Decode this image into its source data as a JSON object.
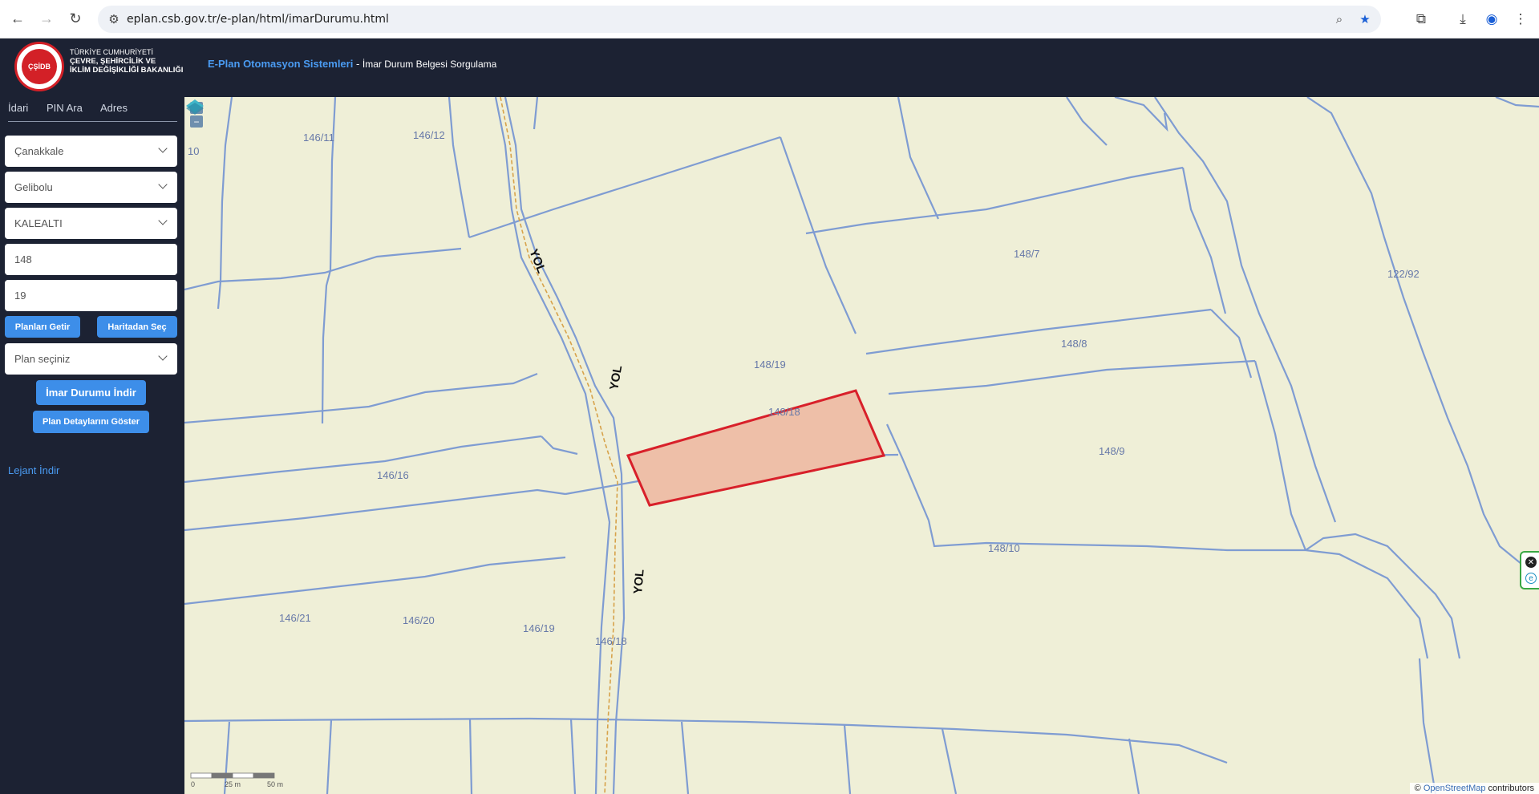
{
  "browser": {
    "url": "eplan.csb.gov.tr/e-plan/html/imarDurumu.html"
  },
  "header": {
    "ministry_line1": "TÜRKİYE CUMHURİYETİ",
    "ministry_line2": "ÇEVRE, ŞEHİRCİLİK VE",
    "ministry_line3": "İKLİM DEĞİŞİKLİĞİ BAKANLIĞI",
    "brand": "E-Plan Otomasyon Sistemleri",
    "separator": " - ",
    "subtitle": "İmar Durum Belgesi Sorgulama"
  },
  "sidebar": {
    "tabs": [
      {
        "label": "İdari"
      },
      {
        "label": "PIN Ara"
      },
      {
        "label": "Adres"
      }
    ],
    "province": "Çanakkale",
    "district": "Gelibolu",
    "neighborhood": "KALEALTI",
    "block": "148",
    "parcel": "19",
    "plans_button": "Planları Getir",
    "map_select_button": "Haritadan Seç",
    "plan_select": "Plan seçiniz",
    "download_button": "İmar Durumu İndir",
    "plan_details_button": "Plan Detaylarını Göster",
    "legend_link": "Lejant İndir"
  },
  "map": {
    "zoom_in": "+",
    "zoom_out": "−",
    "parcels": [
      {
        "label": "146/11"
      },
      {
        "label": "146/12"
      },
      {
        "label": "10"
      },
      {
        "label": "148/7"
      },
      {
        "label": "122/92"
      },
      {
        "label": "148/8"
      },
      {
        "label": "148/19",
        "selected": true
      },
      {
        "label": "148/18"
      },
      {
        "label": "148/9"
      },
      {
        "label": "146/16"
      },
      {
        "label": "148/10"
      },
      {
        "label": "146/21"
      },
      {
        "label": "146/20"
      },
      {
        "label": "146/19"
      },
      {
        "label": "146/18"
      }
    ],
    "road_labels": [
      "YOL",
      "YOL",
      "YOL"
    ],
    "scale_labels": [
      "0",
      "25 m",
      "50 m"
    ],
    "attribution_prefix": "© ",
    "attribution_link": "OpenStreetMap",
    "attribution_suffix": " contributors",
    "colors": {
      "background": "#efefd7",
      "parcel_line": "#7f9cd2",
      "selected_fill": "#eebfa8",
      "selected_stroke": "#d8202a",
      "road_dash": "#d7a24a"
    }
  }
}
